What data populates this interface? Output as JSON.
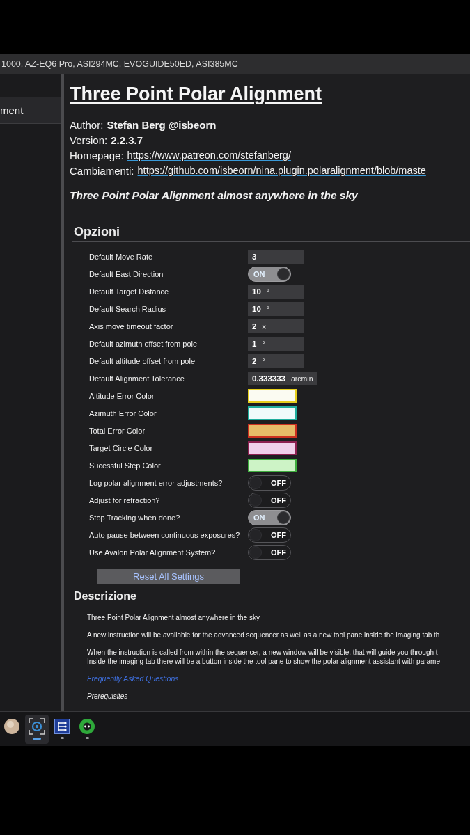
{
  "window": {
    "title": "1000, AZ-EQ6 Pro, ASI294MC, EVOGUIDE50ED, ASI385MC"
  },
  "sidebar": {
    "items": [
      {
        "label": "ment",
        "selected": true
      }
    ]
  },
  "plugin": {
    "title": "Three Point Polar Alignment",
    "meta": [
      {
        "kind": "bold",
        "label": "Author:",
        "value": "Stefan Berg @isbeorn"
      },
      {
        "kind": "bold",
        "label": "Version:",
        "value": "2.2.3.7"
      },
      {
        "kind": "link",
        "label": "Homepage:",
        "value": "https://www.patreon.com/stefanberg/"
      },
      {
        "kind": "link",
        "label": "Cambiamenti:",
        "value": "https://github.com/isbeorn/nina.plugin.polaralignment/blob/maste"
      }
    ],
    "tagline": "Three Point Polar Alignment almost anywhere in the sky"
  },
  "options": {
    "heading": "Opzioni",
    "items": [
      {
        "kind": "number",
        "label": "Default Move Rate",
        "value": "3"
      },
      {
        "kind": "toggle",
        "label": "Default East Direction",
        "on": true,
        "text": "ON"
      },
      {
        "kind": "number",
        "label": "Default Target Distance",
        "value": "10",
        "unit": "°"
      },
      {
        "kind": "number",
        "label": "Default Search Radius",
        "value": "10",
        "unit": "°"
      },
      {
        "kind": "number",
        "label": "Axis move timeout factor",
        "value": "2",
        "unit": "x"
      },
      {
        "kind": "number",
        "label": "Default azimuth offset from pole",
        "value": "1",
        "unit": "°"
      },
      {
        "kind": "number",
        "label": "Default altitude offset from pole",
        "value": "2",
        "unit": "°"
      },
      {
        "kind": "number",
        "label": "Default Alignment Tolerance",
        "value": "0.333333",
        "unit": "arcmin"
      },
      {
        "kind": "color",
        "label": "Altitude Error Color",
        "color": "#fbfbf2",
        "edge": {
          "color": "#e6cf1e"
        }
      },
      {
        "kind": "color",
        "label": "Azimuth Error Color",
        "color": "#f0fbfb",
        "edge": {
          "color": "#1fae9e"
        }
      },
      {
        "kind": "color",
        "label": "Total Error Color",
        "color": "#e6bb68",
        "edge": {
          "color": "#cc3020"
        }
      },
      {
        "kind": "color",
        "label": "Target Circle Color",
        "color": "#f0d0ea",
        "edge": {
          "color": "#8c2050"
        }
      },
      {
        "kind": "color",
        "label": "Sucessful Step Color",
        "color": "#cdf3c6",
        "edge": {
          "color": "#3fae3f"
        }
      },
      {
        "kind": "toggle",
        "label": "Log polar alignment error adjustments?",
        "on": false,
        "text": "OFF"
      },
      {
        "kind": "toggle",
        "label": "Adjust for refraction?",
        "on": false,
        "text": "OFF"
      },
      {
        "kind": "toggle",
        "label": "Stop Tracking when done?",
        "on": true,
        "text": "ON"
      },
      {
        "kind": "toggle",
        "label": "Auto pause between continuous exposures?",
        "on": false,
        "text": "OFF"
      },
      {
        "kind": "toggle",
        "label": "Use Avalon Polar Alignment System?",
        "on": false,
        "text": "OFF"
      }
    ],
    "reset_button": "Reset All Settings"
  },
  "description": {
    "heading": "Descrizione",
    "blocks": [
      {
        "kind": "text",
        "lines": [
          "Three Point Polar Alignment almost anywhere in the sky"
        ]
      },
      {
        "kind": "text",
        "lines": [
          "A new instruction will be available for the advanced sequencer as well as a new tool pane inside the imaging tab th"
        ]
      },
      {
        "kind": "text",
        "lines": [
          "When the instruction is called from within the sequencer, a new window will be visible, that will guide you through t",
          "Inside the imaging tab there will be a button inside the tool pane to show the polar alignment assistant with parame"
        ]
      },
      {
        "kind": "link",
        "lines": [
          "Frequently Asked Questions"
        ]
      },
      {
        "kind": "italic",
        "lines": [
          "Prerequisites"
        ]
      }
    ]
  },
  "taskbar": {
    "items": [
      {
        "kind": "disc",
        "selected": false,
        "running": false
      },
      {
        "kind": "target",
        "selected": true,
        "running": true
      },
      {
        "kind": "list",
        "selected": false,
        "running": true
      },
      {
        "kind": "ring",
        "selected": false,
        "running": true
      }
    ]
  }
}
